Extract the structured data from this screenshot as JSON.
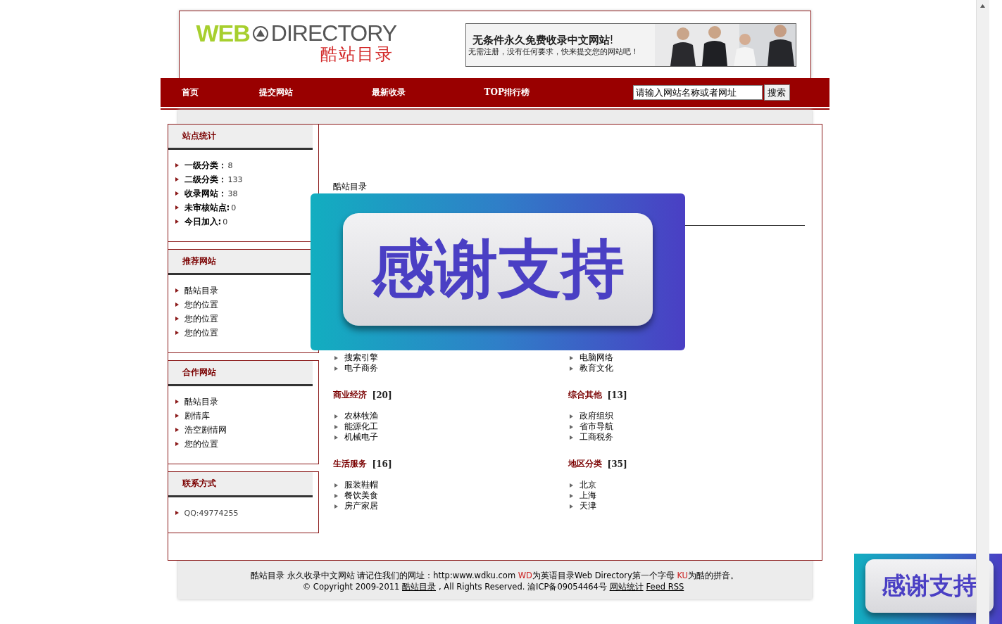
{
  "logo": {
    "word1": "WEB",
    "word2": "DIRECTORY",
    "subtitle": "酷站目录"
  },
  "banner": {
    "headline": "无条件永久免费收录中文网站",
    "mark": "!",
    "subline": "无需注册，没有任何要求，快来提交您的网站吧！"
  },
  "nav": {
    "items": [
      {
        "label": "首页"
      },
      {
        "label": "提交网站"
      },
      {
        "label": "最新收录"
      },
      {
        "label": "TOP排行榜"
      }
    ],
    "search": {
      "placeholder": "请输入网站名称或者网址",
      "button": "搜索"
    }
  },
  "sidebar": [
    {
      "title": "站点统计",
      "items": [
        {
          "kind": "stat",
          "label": "一级分类：",
          "value": "8"
        },
        {
          "kind": "stat",
          "label": "二级分类：",
          "value": "133"
        },
        {
          "kind": "stat",
          "label": "收录网站：",
          "value": "38"
        },
        {
          "kind": "stat",
          "label": "未审核站点:",
          "value": "0"
        },
        {
          "kind": "stat",
          "label": "今日加入:",
          "value": "0"
        }
      ]
    },
    {
      "title": "推荐网站",
      "items": [
        {
          "kind": "link",
          "label": "酷站目录"
        },
        {
          "kind": "link",
          "label": "您的位置"
        },
        {
          "kind": "link",
          "label": "您的位置"
        },
        {
          "kind": "link",
          "label": "您的位置"
        }
      ]
    },
    {
      "title": "合作网站",
      "items": [
        {
          "kind": "link",
          "label": "酷站目录"
        },
        {
          "kind": "link",
          "label": "剧情库"
        },
        {
          "kind": "link",
          "label": "浩空剧情网"
        },
        {
          "kind": "link",
          "label": "您的位置"
        }
      ]
    },
    {
      "title": "联系方式",
      "items": [
        {
          "kind": "text",
          "label": "QQ:49774255"
        }
      ]
    }
  ],
  "main": {
    "breadcrumb": "酷站目录",
    "categories": [
      {
        "items": [
          "搜索引擎",
          "电子商务"
        ]
      },
      {
        "items": [
          "电脑网络",
          "教育文化"
        ]
      },
      {
        "title": "商业经济",
        "count": "[20]",
        "items": [
          "农林牧渔",
          "能源化工",
          "机械电子"
        ]
      },
      {
        "title": "综合其他",
        "count": "[13]",
        "items": [
          "政府组织",
          "省市导航",
          "工商税务"
        ]
      },
      {
        "title": "生活服务",
        "count": "[16]",
        "items": [
          "服装鞋帽",
          "餐饮美食",
          "房产家居"
        ]
      },
      {
        "title": "地区分类",
        "count": "[35]",
        "items": [
          "北京",
          "上海",
          "天津"
        ]
      }
    ]
  },
  "footer": {
    "line1": [
      {
        "kind": "text",
        "text": "酷站目录  永久收录中文网站  请记住我们的网址：http:www.wdku.com "
      },
      {
        "kind": "red",
        "text": "WD"
      },
      {
        "kind": "text",
        "text": "为英语目录Web Directory第一个字母  "
      },
      {
        "kind": "red",
        "text": "KU"
      },
      {
        "kind": "text",
        "text": "为酷的拼音。"
      }
    ],
    "line2": [
      {
        "kind": "text",
        "text": "© Copyright 2009-2011 "
      },
      {
        "kind": "link",
        "text": "酷站目录"
      },
      {
        "kind": "text",
        "text": ", All Rights Reserved. 渝ICP备09054464号 "
      },
      {
        "kind": "link",
        "text": "网站统计"
      },
      {
        "kind": "link",
        "text": "Feed RSS"
      }
    ]
  },
  "popup_ad": {
    "text": "感谢支持"
  },
  "corner_ad": {
    "text": "感谢支持"
  }
}
